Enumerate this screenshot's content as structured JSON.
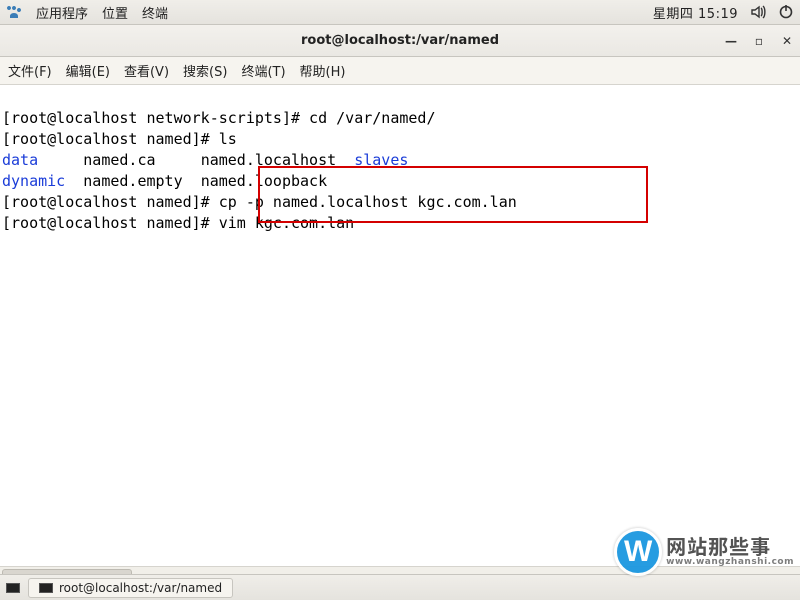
{
  "panel": {
    "apps_label": "应用程序",
    "places_label": "位置",
    "terminal_label": "终端",
    "clock": "星期四 15:19"
  },
  "window": {
    "title": "root@localhost:/var/named"
  },
  "menu": {
    "file": "文件(F)",
    "edit": "编辑(E)",
    "view": "查看(V)",
    "search": "搜索(S)",
    "terminal": "终端(T)",
    "help": "帮助(H)"
  },
  "term": {
    "l1_prompt": "[root@localhost network-scripts]# ",
    "l1_cmd": "cd /var/named/",
    "l2_prompt": "[root@localhost named]# ",
    "l2_cmd": "ls",
    "ls_data": "data",
    "ls_named_ca": "     named.ca     ",
    "ls_named_localhost": "named.localhost  ",
    "ls_slaves": "slaves",
    "ls_dynamic": "dynamic",
    "ls_named_empty": "  named.empty  ",
    "ls_named_loopback": "named.loopback",
    "l5_prompt": "[root@localhost named]# ",
    "l5_cmd": "cp -p named.localhost kgc.com.lan",
    "l6_prompt": "[root@localhost named]# ",
    "l6_cmd": "vim kgc.com.lan"
  },
  "taskbar": {
    "item1": "root@localhost:/var/named"
  },
  "watermark": {
    "letter": "W",
    "cn": "网站那些事",
    "url": "www.wangzhanshi.com"
  }
}
